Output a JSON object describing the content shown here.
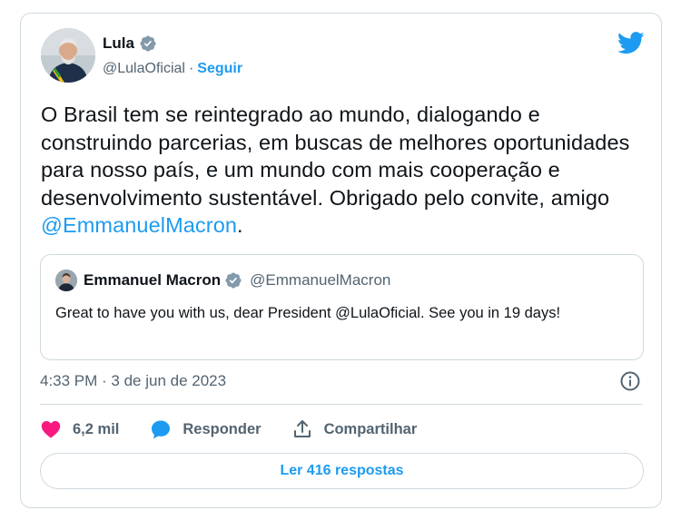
{
  "author": {
    "name": "Lula",
    "handle": "@LulaOficial",
    "separator": "·",
    "follow_label": "Seguir"
  },
  "tweet": {
    "text": "O Brasil tem se reintegrado ao mundo, dialogando e construindo parcerias, em buscas de melhores oportunidades para nosso país, e um mundo com mais cooperação e desenvolvimento sustentável. Obrigado pelo convite, amigo ",
    "mention": "@EmmanuelMacron",
    "text_end": "."
  },
  "quote": {
    "name": "Emmanuel Macron",
    "handle": "@EmmanuelMacron",
    "text": "Great to have you with us, dear President @LulaOficial. See you in 19 days!"
  },
  "meta": {
    "timestamp": "4:33 PM · 3 de jun de 2023"
  },
  "actions": {
    "likes": "6,2 mil",
    "reply_label": "Responder",
    "share_label": "Compartilhar"
  },
  "read_replies_label": "Ler 416 respostas",
  "colors": {
    "accent": "#1d9bf0",
    "like": "#f91880",
    "text": "#0f1419",
    "muted": "#536471",
    "border": "#cfd9de"
  },
  "icons": [
    "verified-badge-icon",
    "twitter-bird-icon",
    "info-icon",
    "heart-icon",
    "reply-bubble-icon",
    "share-icon"
  ]
}
